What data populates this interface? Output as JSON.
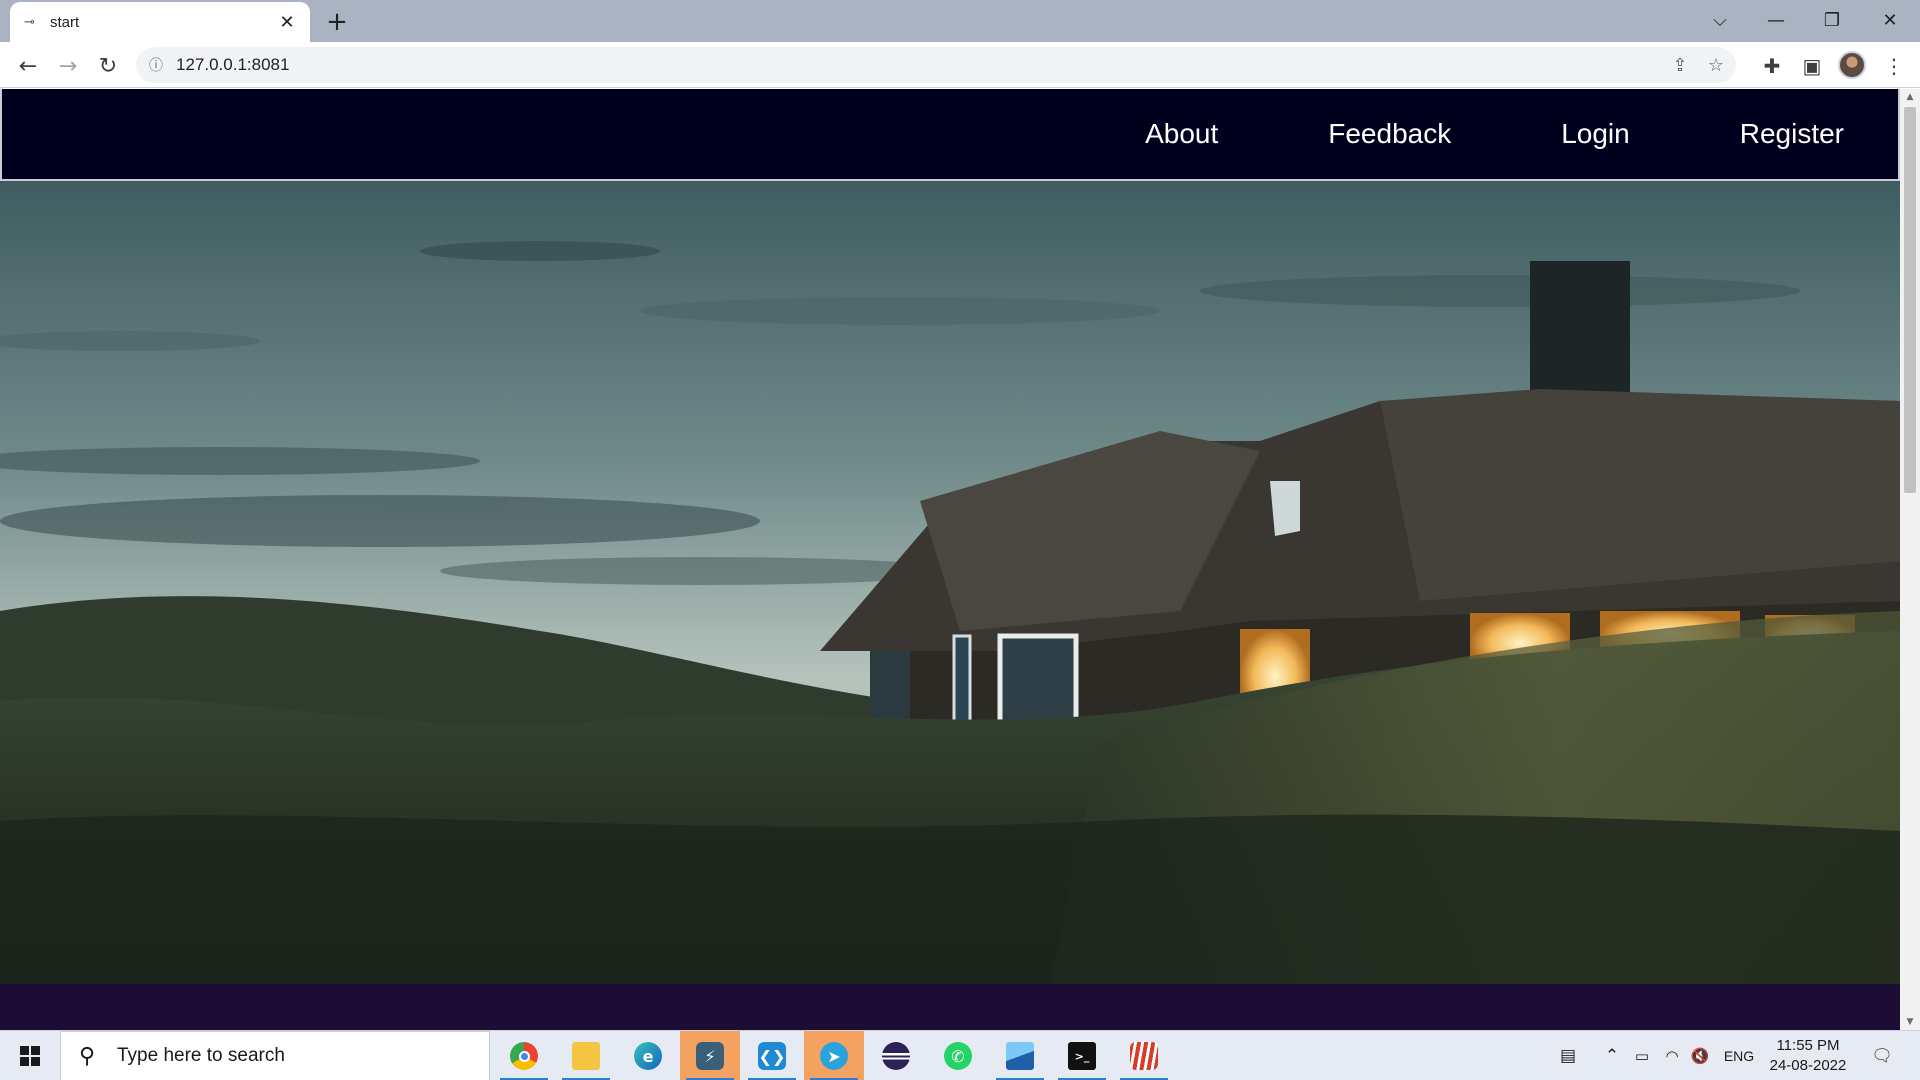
{
  "browser": {
    "tab": {
      "title": "start",
      "favicon": "link-favicon-icon"
    },
    "url": "127.0.0.1:8081",
    "window_controls": [
      "tab-search-icon",
      "minimize-icon",
      "restore-icon",
      "close-icon"
    ],
    "toolbar_icons": [
      "share-icon",
      "star-icon",
      "extensions-icon",
      "side-panel-icon",
      "profile-avatar",
      "more-menu-icon"
    ]
  },
  "site": {
    "nav": [
      "About",
      "Feedback",
      "Login",
      "Register"
    ],
    "colors": {
      "nav_bg": "#00001e",
      "footer_bg": "#1b0d33",
      "nav_text": "#ffffff"
    },
    "hero_image": "dusk photo of thatched-roof cottage with glowing windows in dune grass"
  },
  "taskbar": {
    "search_placeholder": "Type here to search",
    "apps": [
      "chrome-icon",
      "file-explorer-icon",
      "edge-icon",
      "mysql-workbench-icon",
      "vscode-icon",
      "telegram-icon",
      "eclipse-icon",
      "whatsapp-icon",
      "photos-icon",
      "terminal-icon",
      "app-icon"
    ],
    "language": "ENG",
    "time": "11:55 PM",
    "date": "24-08-2022"
  }
}
